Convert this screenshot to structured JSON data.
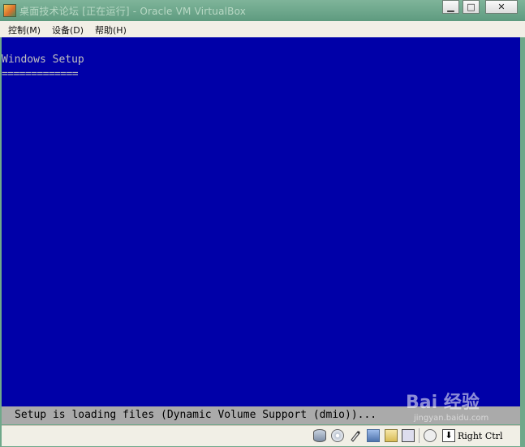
{
  "window": {
    "title": "桌面技术论坛 [正在运行] - Oracle VM VirtualBox",
    "minimize_glyph": "▁",
    "maximize_glyph": "□",
    "close_glyph": "✕"
  },
  "menu": {
    "items": [
      {
        "label": "控制(M)"
      },
      {
        "label": "设备(D)"
      },
      {
        "label": "帮助(H)"
      }
    ]
  },
  "guest_screen": {
    "heading": "Windows Setup",
    "underline": "=============",
    "status": "Setup is loading files (Dynamic Volume Support (dmio))..."
  },
  "statusbar": {
    "indicators": [
      "hard-disk-icon",
      "optical-drive-icon",
      "usb-icon",
      "network-icon",
      "shared-folder-icon",
      "display-icon",
      "mouse-integration-icon",
      "keyboard-icon"
    ],
    "host_key": "Right Ctrl"
  },
  "watermark": {
    "main": "Bai 经验",
    "sub": "jingyan.baidu.com"
  },
  "colors": {
    "guest_background": "#0000a8",
    "guest_text": "#c0c0c0",
    "guest_statusbar": "#aaaaaa"
  }
}
